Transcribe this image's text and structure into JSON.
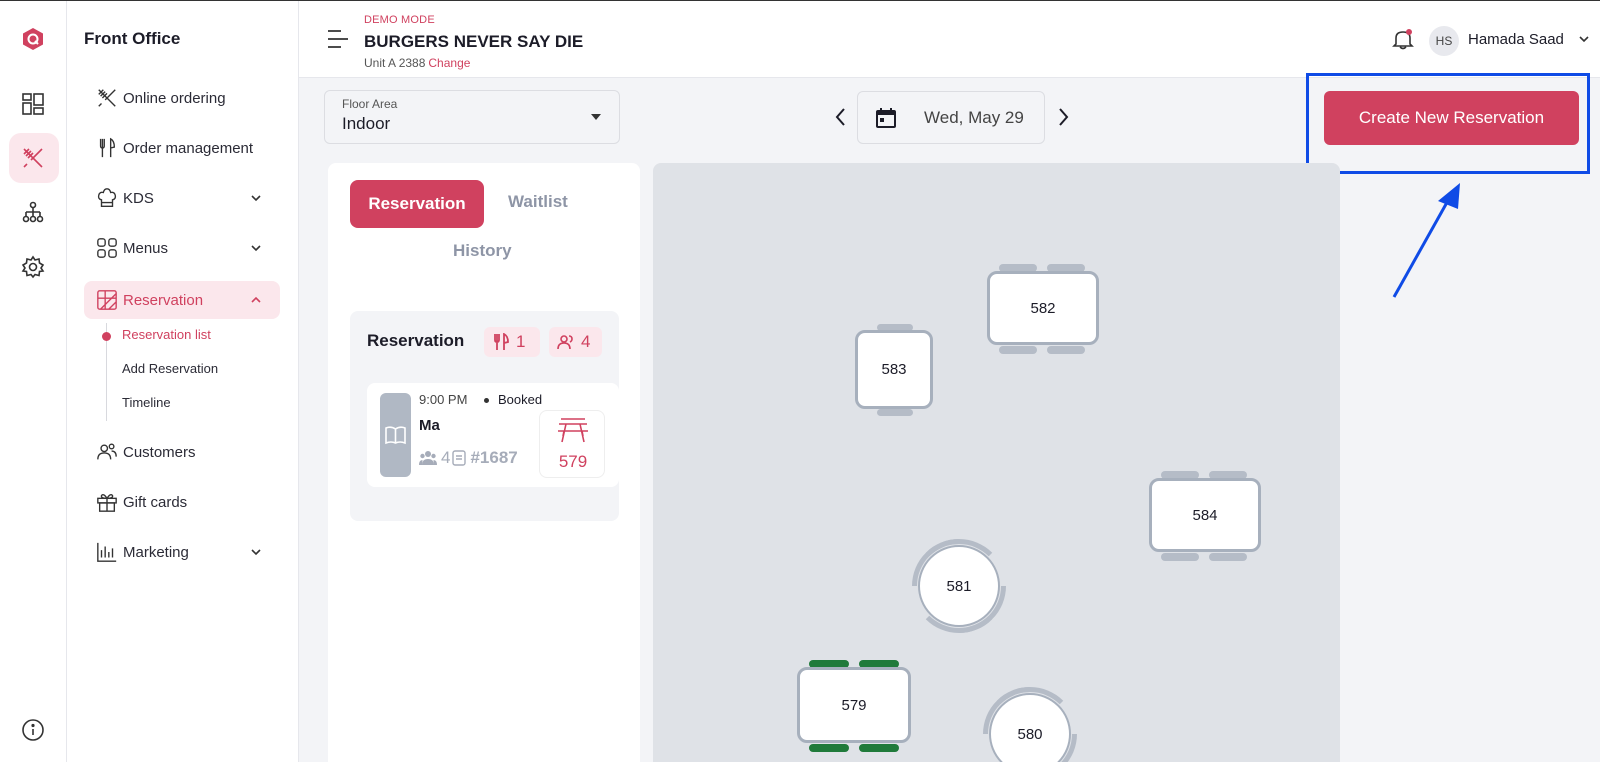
{
  "rail": {
    "icons": [
      "logo-icon",
      "dashboard-icon",
      "front-office-icon",
      "org-icon",
      "settings-icon",
      "info-icon"
    ]
  },
  "sidebar": {
    "title": "Front Office",
    "items": [
      {
        "label": "Online ordering",
        "icon": "utensils-cross-icon"
      },
      {
        "label": "Order management",
        "icon": "fork-knife-icon"
      },
      {
        "label": "KDS",
        "icon": "chef-hat-icon",
        "expandable": true
      },
      {
        "label": "Menus",
        "icon": "grid-icon",
        "expandable": true
      },
      {
        "label": "Reservation",
        "icon": "reservation-icon",
        "expandable": true,
        "active": true
      },
      {
        "label": "Customers",
        "icon": "users-icon"
      },
      {
        "label": "Gift cards",
        "icon": "gift-icon"
      },
      {
        "label": "Marketing",
        "icon": "chart-bars-icon",
        "expandable": true
      }
    ],
    "sub_items": [
      {
        "label": "Reservation list",
        "active": true
      },
      {
        "label": "Add Reservation"
      },
      {
        "label": "Timeline"
      }
    ]
  },
  "header": {
    "demo_label": "DEMO MODE",
    "store_name": "BURGERS NEVER SAY DIE",
    "unit": "Unit A 2388",
    "change_label": "Change",
    "user_initials": "HS",
    "user_name": "Hamada Saad"
  },
  "controls": {
    "floor_label": "Floor Area",
    "floor_value": "Indoor",
    "date": "Wed, May 29",
    "create_button": "Create New Reservation"
  },
  "tabs": {
    "reservation": "Reservation",
    "waitlist": "Waitlist",
    "history": "History"
  },
  "reservations": {
    "title": "Reservation",
    "tables_count": "1",
    "guests_count": "4",
    "card": {
      "time": "9:00 PM",
      "status": "Booked",
      "name": "Ma",
      "party": "4",
      "id": "#1687",
      "table": "579"
    }
  },
  "tables": [
    {
      "number": "582",
      "shape": "rect"
    },
    {
      "number": "583",
      "shape": "rect"
    },
    {
      "number": "584",
      "shape": "rect"
    },
    {
      "number": "581",
      "shape": "round"
    },
    {
      "number": "579",
      "shape": "rect",
      "occupied": true
    },
    {
      "number": "580",
      "shape": "round"
    }
  ],
  "colors": {
    "accent": "#d0415f",
    "accent_light": "#fbe7ec",
    "highlight": "#0f4be6",
    "occupied": "#1f7a3a"
  }
}
